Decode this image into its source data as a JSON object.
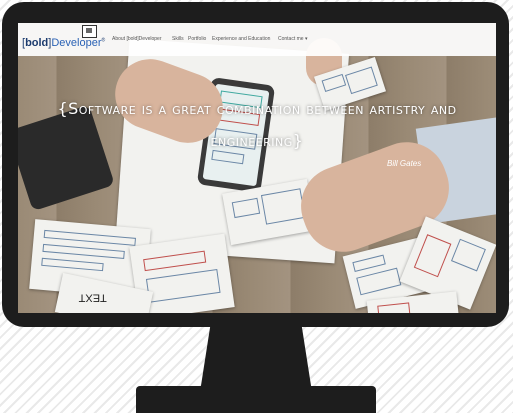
{
  "window": {
    "logo": {
      "bracket_open": "[",
      "bold": "bold",
      "bracket_close": "]",
      "developer": "Developer",
      "mark": "®"
    },
    "nav": [
      {
        "label": "About [bold]Developer"
      },
      {
        "label": "Skills"
      },
      {
        "label": "Portfolio"
      },
      {
        "label": "Experience and Education"
      },
      {
        "label": "Contact me ▾"
      }
    ]
  },
  "hero": {
    "quote": "{Software is a great combination between artistry and engineering}",
    "author": "Bill Gates",
    "paper_word": "TEXT"
  },
  "colors": {
    "monitor": "#1d1d1d",
    "logo_dark": "#1c3b6e",
    "logo_accent": "#2b62b5",
    "quote_text": "#ffffff"
  },
  "icons": [
    "logo-frame-icon"
  ]
}
